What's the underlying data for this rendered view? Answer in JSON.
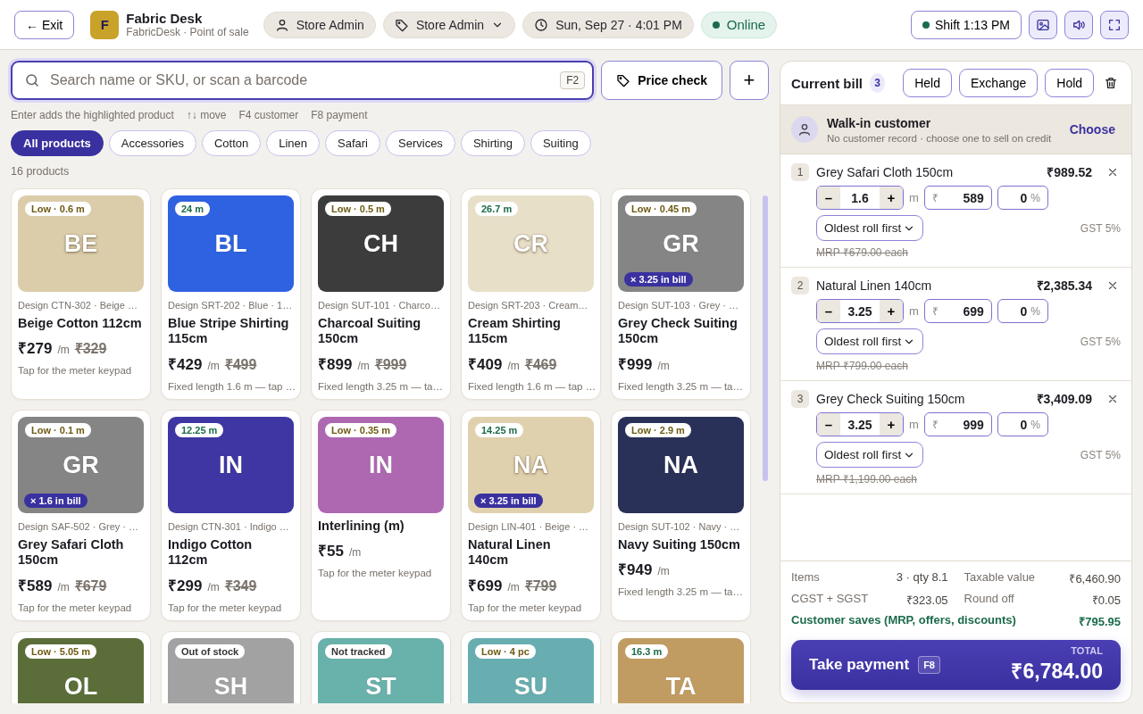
{
  "header": {
    "exit": "← Exit",
    "logo_letter": "F",
    "title": "Fabric Desk",
    "subtitle": "FabricDesk · Point of sale",
    "pills": [
      {
        "kind": "user",
        "text": "Store Admin"
      },
      {
        "kind": "role",
        "text": "Store Admin"
      },
      {
        "kind": "time",
        "text": "Sun, Sep 27 · 4:01 PM"
      },
      {
        "kind": "status",
        "text": "Online"
      }
    ],
    "shift": {
      "label": "Shift",
      "time": "1:13 PM"
    }
  },
  "search": {
    "placeholder": "Search name or SKU, or scan a barcode",
    "key": "F2",
    "price_check": "Price check",
    "add": "+"
  },
  "hints": [
    "Enter adds the highlighted product",
    "↑↓ move",
    "F4 customer",
    "F8 payment"
  ],
  "categories": [
    {
      "label": "All products",
      "selected": true
    },
    {
      "label": "Accessories",
      "selected": false
    },
    {
      "label": "Cotton",
      "selected": false
    },
    {
      "label": "Linen",
      "selected": false
    },
    {
      "label": "Safari",
      "selected": false
    },
    {
      "label": "Services",
      "selected": false
    },
    {
      "label": "Shirting",
      "selected": false
    },
    {
      "label": "Suiting",
      "selected": false
    }
  ],
  "product_count": "16 products",
  "products": [
    {
      "initials": "BE",
      "color": "#dbcdaa",
      "tag": {
        "text": "Low · 0.6 m",
        "kind": "low"
      },
      "design": "Design CTN-302 · Beige …",
      "name": "Beige Cotton 112cm",
      "price": "₹279",
      "unit": "/m",
      "mrp": "₹329",
      "note": "Tap for the meter keypad"
    },
    {
      "initials": "BL",
      "color": "#2f62e0",
      "tag": {
        "text": "24 m",
        "kind": "ok"
      },
      "design": "Design SRT-202 · Blue · 1…",
      "name": "Blue Stripe Shirting 115cm",
      "price": "₹429",
      "unit": "/m",
      "mrp": "₹499",
      "note": "Fixed length 1.6 m — tap …"
    },
    {
      "initials": "CH",
      "color": "#3c3c3c",
      "tag": {
        "text": "Low · 0.5 m",
        "kind": "low"
      },
      "design": "Design SUT-101 · Charco…",
      "name": "Charcoal Suiting 150cm",
      "price": "₹899",
      "unit": "/m",
      "mrp": "₹999",
      "note": "Fixed length 3.25 m — ta…"
    },
    {
      "initials": "CR",
      "color": "#e8dfc9",
      "tag": {
        "text": "26.7 m",
        "kind": "ok"
      },
      "design": "Design SRT-203 · Cream…",
      "name": "Cream Shirting 115cm",
      "price": "₹409",
      "unit": "/m",
      "mrp": "₹469",
      "note": "Fixed length 1.6 m — tap …"
    },
    {
      "initials": "GR",
      "color": "#858585",
      "tag": {
        "text": "Low · 0.45 m",
        "kind": "low"
      },
      "in_bill": "× 3.25 in bill",
      "design": "Design SUT-103 · Grey · …",
      "name": "Grey Check Suiting 150cm",
      "price": "₹999",
      "unit": "/m",
      "note": "Fixed length 3.25 m — ta…"
    },
    {
      "initials": "GR",
      "color": "#858585",
      "tag": {
        "text": "Low · 0.1 m",
        "kind": "low"
      },
      "in_bill": "× 1.6 in bill",
      "design": "Design SAF-502 · Grey · …",
      "name": "Grey Safari Cloth 150cm",
      "price": "₹589",
      "unit": "/m",
      "mrp": "₹679",
      "note": "Tap for the meter keypad"
    },
    {
      "initials": "IN",
      "color": "#3e36a2",
      "tag": {
        "text": "12.25 m",
        "kind": "ok"
      },
      "design": "Design CTN-301 · Indigo …",
      "name": "Indigo Cotton 112cm",
      "price": "₹299",
      "unit": "/m",
      "mrp": "₹349",
      "note": "Tap for the meter keypad"
    },
    {
      "initials": "IN",
      "color": "#ae68b2",
      "tag": {
        "text": "Low · 0.35 m",
        "kind": "low"
      },
      "name": "Interlining (m)",
      "price": "₹55",
      "unit": "/m",
      "note": "Tap for the meter keypad"
    },
    {
      "initials": "NA",
      "color": "#e0d1ae",
      "tag": {
        "text": "14.25 m",
        "kind": "ok"
      },
      "in_bill": "× 3.25 in bill",
      "design": "Design LIN-401 · Beige · …",
      "name": "Natural Linen 140cm",
      "price": "₹699",
      "unit": "/m",
      "mrp": "₹799",
      "note": "Tap for the meter keypad"
    },
    {
      "initials": "NA",
      "color": "#2a3158",
      "tag": {
        "text": "Low · 2.9 m",
        "kind": "low"
      },
      "design": "Design SUT-102 · Navy · …",
      "name": "Navy Suiting 150cm",
      "price": "₹949",
      "unit": "/m",
      "note": "Fixed length 3.25 m — ta…"
    },
    {
      "initials": "OL",
      "color": "#5b6e3a",
      "tag": {
        "text": "Low · 5.05 m",
        "kind": "low"
      }
    },
    {
      "initials": "SH",
      "color": "#a2a2a2",
      "tag": {
        "text": "Out of stock",
        "kind": "none"
      }
    },
    {
      "initials": "ST",
      "color": "#69b1ab",
      "tag": {
        "text": "Not tracked",
        "kind": "none"
      }
    },
    {
      "initials": "SU",
      "color": "#68aeb1",
      "tag": {
        "text": "Low · 4 pc",
        "kind": "low"
      }
    },
    {
      "initials": "TA",
      "color": "#c19c62",
      "tag": {
        "text": "16.3 m",
        "kind": "ok"
      }
    }
  ],
  "bill": {
    "title": "Current bill",
    "count": "3",
    "actions": [
      "Held",
      "Exchange",
      "Hold"
    ],
    "customer": {
      "name": "Walk-in customer",
      "note": "No customer record · choose one to sell on credit",
      "choose": "Choose"
    },
    "lines": [
      {
        "number": "1",
        "name": "Grey Safari Cloth 150cm",
        "total": "₹989.52",
        "decrement": "–",
        "qty": "1.6",
        "increment": "+",
        "unit": "m",
        "currency": "₹",
        "price": "589",
        "discount": "0",
        "percent": "%",
        "roll": "Oldest roll first",
        "gst": "GST 5%",
        "mrp": "MRP ₹679.00 each"
      },
      {
        "number": "2",
        "name": "Natural Linen 140cm",
        "total": "₹2,385.34",
        "decrement": "–",
        "qty": "3.25",
        "increment": "+",
        "unit": "m",
        "currency": "₹",
        "price": "699",
        "discount": "0",
        "percent": "%",
        "roll": "Oldest roll first",
        "gst": "GST 5%",
        "mrp": "MRP ₹799.00 each"
      },
      {
        "number": "3",
        "name": "Grey Check Suiting 150cm",
        "total": "₹3,409.09",
        "decrement": "–",
        "qty": "3.25",
        "increment": "+",
        "unit": "m",
        "currency": "₹",
        "price": "999",
        "discount": "0",
        "percent": "%",
        "roll": "Oldest roll first",
        "gst": "GST 5%",
        "mrp": "MRP ₹1,199.00 each"
      }
    ],
    "summary": [
      {
        "label": "Items",
        "value": "3 · qty 8.1"
      },
      {
        "label": "Taxable value",
        "value": "₹6,460.90"
      },
      {
        "label": "CGST + SGST",
        "value": "₹323.05"
      },
      {
        "label": "Round off",
        "value": "₹0.05"
      }
    ],
    "savings": {
      "label": "Customer saves (MRP, offers, discounts)",
      "value": "₹795.95"
    },
    "payment": {
      "label": "Take payment",
      "key": "F8",
      "total_label": "TOTAL",
      "total": "₹6,784.00"
    }
  }
}
